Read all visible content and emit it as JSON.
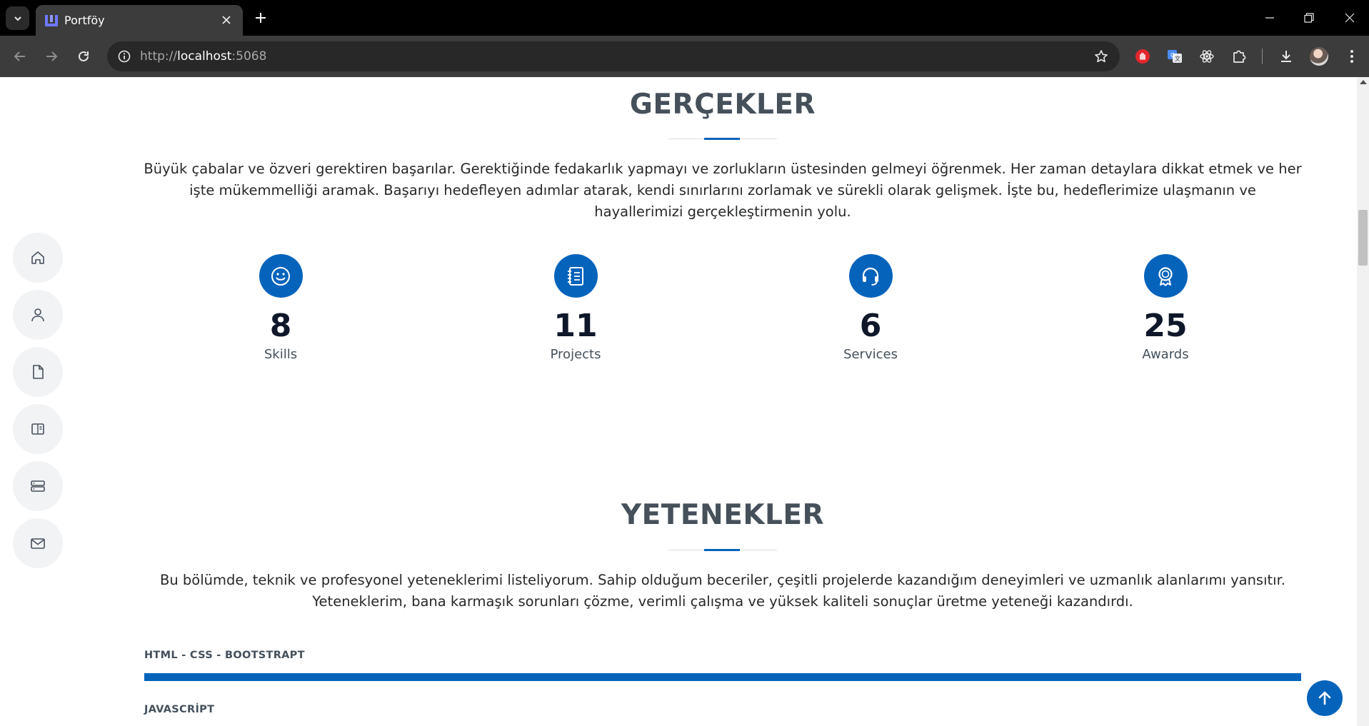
{
  "browser": {
    "tab_title": "Portföy",
    "url_scheme": "http://",
    "url_host": "localhost",
    "url_port": ":5068"
  },
  "side_nav": [
    {
      "icon": "home-icon"
    },
    {
      "icon": "user-icon"
    },
    {
      "icon": "file-icon"
    },
    {
      "icon": "book-icon"
    },
    {
      "icon": "server-icon"
    },
    {
      "icon": "mail-icon"
    }
  ],
  "facts": {
    "title": "GERÇEKLER",
    "description": "Büyük çabalar ve özveri gerektiren başarılar. Gerektiğinde fedakarlık yapmayı ve zorlukların üstesinden gelmeyi öğrenmek. Her zaman detaylara dikkat etmek ve her işte mükemmelliği aramak. Başarıyı hedefleyen adımlar atarak, kendi sınırlarını zorlamak ve sürekli olarak gelişmek. İşte bu, hedeflerimize ulaşmanın ve hayallerimizi gerçekleştirmenin yolu.",
    "items": [
      {
        "number": "8",
        "label": "Skills",
        "icon": "smile-icon"
      },
      {
        "number": "11",
        "label": "Projects",
        "icon": "journal-icon"
      },
      {
        "number": "6",
        "label": "Services",
        "icon": "headset-icon"
      },
      {
        "number": "25",
        "label": "Awards",
        "icon": "award-icon"
      }
    ]
  },
  "skills": {
    "title": "YETENEKLER",
    "description": "Bu bölümde, teknik ve profesyonel yeteneklerimi listeliyorum. Sahip olduğum beceriler, çeşitli projelerde kazandığım deneyimleri ve uzmanlık alanlarımı yansıtır. Yeteneklerim, bana karmaşık sorunları çözme, verimli çalışma ve yüksek kaliteli sonuçlar üretme yeteneği kazandırdı.",
    "items": [
      {
        "name": "HTML - CSS - BOOTSTRAPT",
        "level": 1.0
      },
      {
        "name": "JAVASCRİPT"
      }
    ]
  },
  "colors": {
    "accent": "#0563bb",
    "heading": "#45505b",
    "text": "#272829"
  }
}
